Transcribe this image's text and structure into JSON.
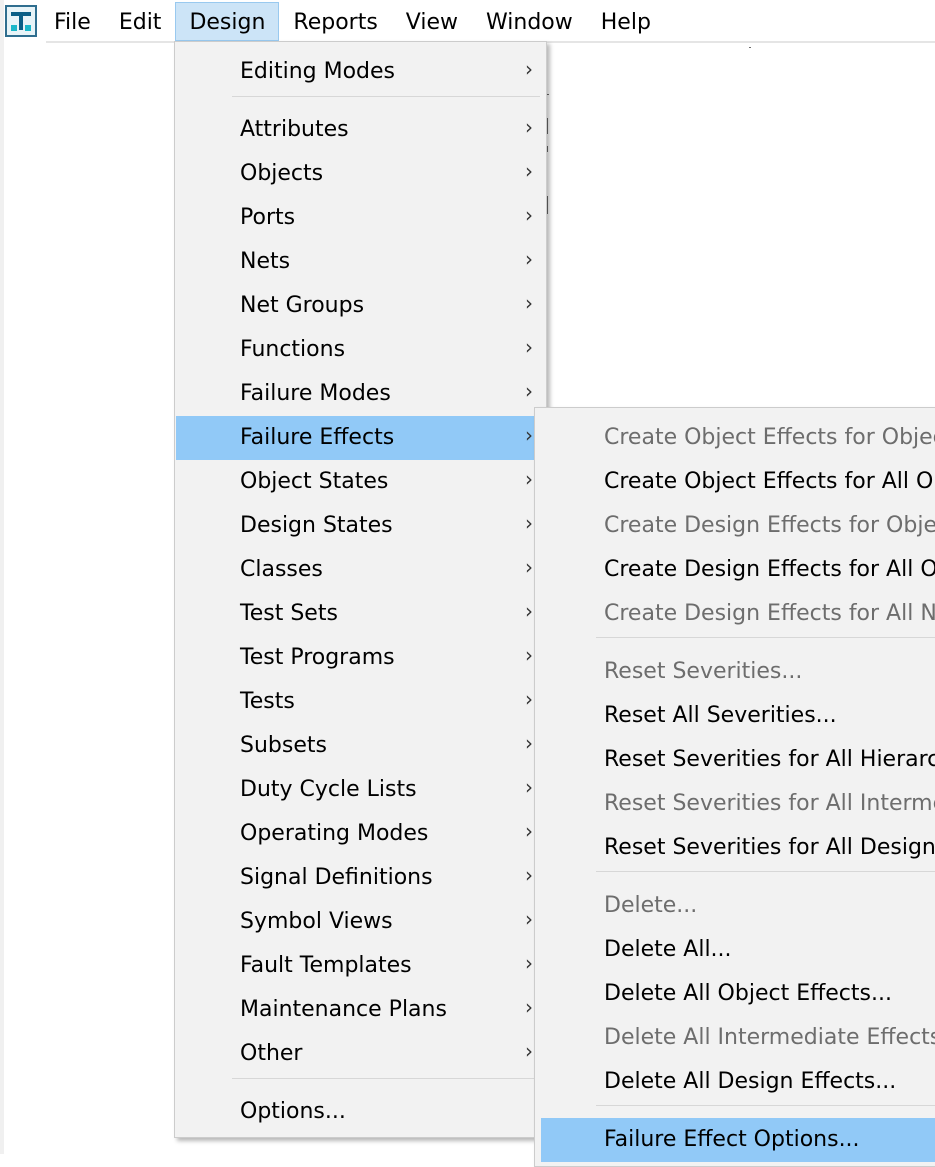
{
  "menubar": {
    "items": [
      "File",
      "Edit",
      "Design",
      "Reports",
      "View",
      "Window",
      "Help"
    ],
    "active": "Design"
  },
  "design_menu": {
    "items": [
      {
        "label": "Editing Modes",
        "submenu": true
      },
      {
        "label": "Attributes",
        "submenu": true
      },
      {
        "label": "Objects",
        "submenu": true
      },
      {
        "label": "Ports",
        "submenu": true
      },
      {
        "label": "Nets",
        "submenu": true
      },
      {
        "label": "Net Groups",
        "submenu": true
      },
      {
        "label": "Functions",
        "submenu": true
      },
      {
        "label": "Failure Modes",
        "submenu": true
      },
      {
        "label": "Failure Effects",
        "submenu": true,
        "highlighted": true
      },
      {
        "label": "Object States",
        "submenu": true
      },
      {
        "label": "Design States",
        "submenu": true
      },
      {
        "label": "Classes",
        "submenu": true
      },
      {
        "label": "Test Sets",
        "submenu": true
      },
      {
        "label": "Test Programs",
        "submenu": true
      },
      {
        "label": "Tests",
        "submenu": true
      },
      {
        "label": "Subsets",
        "submenu": true
      },
      {
        "label": "Duty Cycle Lists",
        "submenu": true
      },
      {
        "label": "Operating Modes",
        "submenu": true
      },
      {
        "label": "Signal Definitions",
        "submenu": true
      },
      {
        "label": "Symbol Views",
        "submenu": true
      },
      {
        "label": "Fault Templates",
        "submenu": true
      },
      {
        "label": "Maintenance Plans",
        "submenu": true
      },
      {
        "label": "Other",
        "submenu": true
      },
      {
        "label": "Options...",
        "submenu": false
      }
    ],
    "submenu_arrow": "›"
  },
  "failure_effects_submenu": {
    "items": [
      {
        "label": "Create Object Effects for Object",
        "enabled": false
      },
      {
        "label": "Create Object Effects for All Obje",
        "enabled": true
      },
      {
        "label": "Create Design Effects for Object",
        "enabled": false
      },
      {
        "label": "Create Design Effects for All Obj",
        "enabled": true
      },
      {
        "label": "Create Design Effects for All Non",
        "enabled": false
      },
      {
        "label": "Reset Severities...",
        "enabled": false
      },
      {
        "label": "Reset All Severities...",
        "enabled": true
      },
      {
        "label": "Reset Severities for All Hierarchic",
        "enabled": true
      },
      {
        "label": "Reset Severities for All Intermedi",
        "enabled": false
      },
      {
        "label": "Reset Severities for All Design Ef",
        "enabled": true
      },
      {
        "label": "Delete...",
        "enabled": false
      },
      {
        "label": "Delete All...",
        "enabled": true
      },
      {
        "label": "Delete All Object Effects...",
        "enabled": true
      },
      {
        "label": "Delete All Intermediate Effects...",
        "enabled": false
      },
      {
        "label": "Delete All Design Effects...",
        "enabled": true
      },
      {
        "label": "Failure Effect Options...",
        "enabled": true,
        "highlighted": true
      }
    ]
  },
  "colors": {
    "menu_bg": "#f2f2f2",
    "highlight": "#91c9f7",
    "menubar_active": "#cce4f7",
    "disabled_text": "#6d6d6d"
  }
}
